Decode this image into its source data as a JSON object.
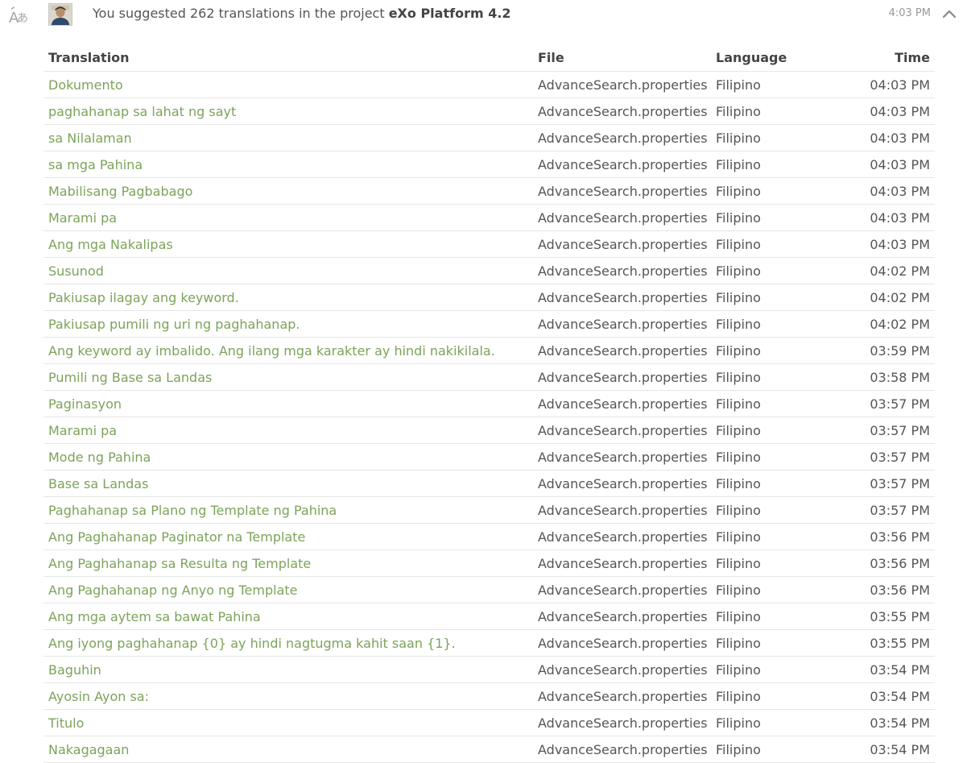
{
  "header": {
    "message": "You suggested 262 translations in the project ",
    "project": "eXo Platform 4.2",
    "time": "4:03 PM"
  },
  "icons": {
    "translate": "translate-icon",
    "avatar": "user-avatar",
    "collapse": "chevron-up-icon"
  },
  "colors": {
    "link": "#7ca35a",
    "text": "#555555",
    "muted": "#999999",
    "divider": "#e6e6e6"
  },
  "table": {
    "headers": {
      "translation": "Translation",
      "file": "File",
      "language": "Language",
      "time": "Time"
    },
    "rows": [
      [
        "Dokumento",
        "AdvanceSearch.properties",
        "Filipino",
        "04:03 PM"
      ],
      [
        "paghahanap sa lahat ng sayt",
        "AdvanceSearch.properties",
        "Filipino",
        "04:03 PM"
      ],
      [
        "sa Nilalaman",
        "AdvanceSearch.properties",
        "Filipino",
        "04:03 PM"
      ],
      [
        "sa mga Pahina",
        "AdvanceSearch.properties",
        "Filipino",
        "04:03 PM"
      ],
      [
        "Mabilisang Pagbabago",
        "AdvanceSearch.properties",
        "Filipino",
        "04:03 PM"
      ],
      [
        "Marami pa",
        "AdvanceSearch.properties",
        "Filipino",
        "04:03 PM"
      ],
      [
        "Ang mga Nakalipas",
        "AdvanceSearch.properties",
        "Filipino",
        "04:03 PM"
      ],
      [
        "Susunod",
        "AdvanceSearch.properties",
        "Filipino",
        "04:02 PM"
      ],
      [
        "Pakiusap ilagay ang keyword.",
        "AdvanceSearch.properties",
        "Filipino",
        "04:02 PM"
      ],
      [
        "Pakiusap pumili ng uri ng paghahanap.",
        "AdvanceSearch.properties",
        "Filipino",
        "04:02 PM"
      ],
      [
        "Ang keyword ay imbalido. Ang ilang mga karakter ay hindi nakikilala.",
        "AdvanceSearch.properties",
        "Filipino",
        "03:59 PM"
      ],
      [
        "Pumili ng Base sa Landas",
        "AdvanceSearch.properties",
        "Filipino",
        "03:58 PM"
      ],
      [
        "Paginasyon",
        "AdvanceSearch.properties",
        "Filipino",
        "03:57 PM"
      ],
      [
        "Marami pa",
        "AdvanceSearch.properties",
        "Filipino",
        "03:57 PM"
      ],
      [
        "Mode ng Pahina",
        "AdvanceSearch.properties",
        "Filipino",
        "03:57 PM"
      ],
      [
        "Base sa Landas",
        "AdvanceSearch.properties",
        "Filipino",
        "03:57 PM"
      ],
      [
        "Paghahanap sa Plano ng Template ng Pahina",
        "AdvanceSearch.properties",
        "Filipino",
        "03:57 PM"
      ],
      [
        "Ang Paghahanap Paginator na Template",
        "AdvanceSearch.properties",
        "Filipino",
        "03:56 PM"
      ],
      [
        "Ang Paghahanap sa Resulta ng Template",
        "AdvanceSearch.properties",
        "Filipino",
        "03:56 PM"
      ],
      [
        "Ang Paghahanap ng Anyo ng Template",
        "AdvanceSearch.properties",
        "Filipino",
        "03:56 PM"
      ],
      [
        "Ang mga aytem sa bawat Pahina",
        "AdvanceSearch.properties",
        "Filipino",
        "03:55 PM"
      ],
      [
        "Ang iyong paghahanap {0} ay hindi nagtugma kahit saan {1}.",
        "AdvanceSearch.properties",
        "Filipino",
        "03:55 PM"
      ],
      [
        "Baguhin",
        "AdvanceSearch.properties",
        "Filipino",
        "03:54 PM"
      ],
      [
        "Ayosin Ayon sa:",
        "AdvanceSearch.properties",
        "Filipino",
        "03:54 PM"
      ],
      [
        "Titulo",
        "AdvanceSearch.properties",
        "Filipino",
        "03:54 PM"
      ],
      [
        "Nakagagaan",
        "AdvanceSearch.properties",
        "Filipino",
        "03:54 PM"
      ]
    ]
  }
}
